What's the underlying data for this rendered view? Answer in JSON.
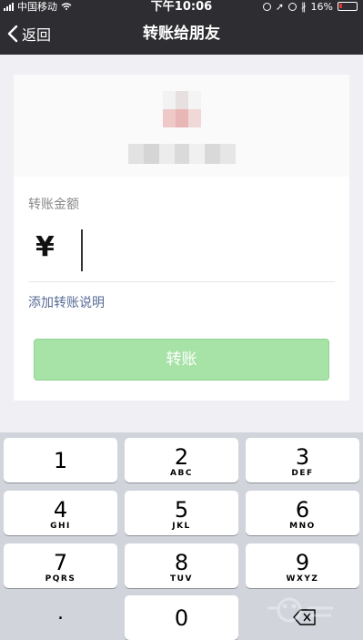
{
  "status_bar": {
    "carrier": "中国移动",
    "time": "下午10:06",
    "battery": "16%"
  },
  "nav": {
    "back_label": "返回",
    "title": "转账给朋友"
  },
  "form": {
    "amount_label": "转账金额",
    "currency_symbol": "¥",
    "amount_value": "",
    "add_note": "添加转账说明",
    "transfer_button": "转账"
  },
  "keypad": {
    "keys": [
      {
        "num": "1",
        "letters": ""
      },
      {
        "num": "2",
        "letters": "ABC"
      },
      {
        "num": "3",
        "letters": "DEF"
      },
      {
        "num": "4",
        "letters": "GHI"
      },
      {
        "num": "5",
        "letters": "JKL"
      },
      {
        "num": "6",
        "letters": "MNO"
      },
      {
        "num": "7",
        "letters": "PQRS"
      },
      {
        "num": "8",
        "letters": "TUV"
      },
      {
        "num": "9",
        "letters": "WXYZ"
      }
    ],
    "dot": ".",
    "zero": "0"
  },
  "colors": {
    "nav_bg": "#2e2e32",
    "transfer_button_disabled": "#a7e3a7",
    "link": "#576b95",
    "keypad_bg": "#d1d5db"
  }
}
